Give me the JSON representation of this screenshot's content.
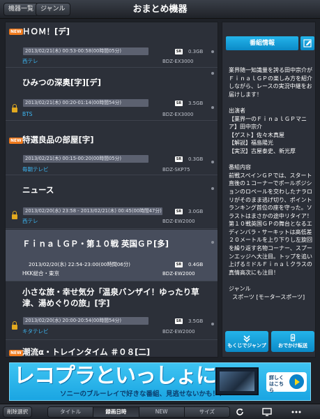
{
  "header": {
    "left_buttons": [
      "機器一覧",
      "ジャンル"
    ],
    "title": "おまとめ機器"
  },
  "list": [
    {
      "new": "NEW",
      "title": "ＨＯＭ！[デ]",
      "date": "2013/02/21(木) 00:53-00:58(00時間05分)",
      "sr": "SR",
      "size": "0.3GB",
      "channel": "西テレ",
      "device": "BDZ-EX3000",
      "locked": false,
      "selected": false
    },
    {
      "new": "",
      "title": "ひみつの深奥[字][デ]",
      "date": "2013/02/21(木) 00:20-01:14(00時間54分)",
      "sr": "SR",
      "size": "3.5GB",
      "channel": "BTS",
      "device": "BDZ-EX3000",
      "locked": true,
      "selected": false
    },
    {
      "new": "NEW",
      "title": "特選良品の部屋[字]",
      "date": "2013/02/21(木) 00:15-00:20(00時間05分)",
      "sr": "SR",
      "size": "0.3GB",
      "channel": "毎朝テレビ",
      "device": "BDZ-SKP75",
      "locked": false,
      "selected": false
    },
    {
      "new": "",
      "title": "ニュース",
      "date": "2013/02/20(水) 23:58 - 2013/02/21(木) 00:45(00時間47分)",
      "sr": "SR",
      "size": "3.0GB",
      "channel": "西テレ",
      "device": "BDZ-EW2000",
      "locked": true,
      "selected": false
    },
    {
      "new": "",
      "title": "ＦｉｎａｌＧＰ・第１０戦 英国ＧＰ[多]",
      "date": "2013/02/20(水) 22:54-23:00(00時間06分)",
      "sr": "SR",
      "size": "0.4GB",
      "channel": "HKK総合・東京",
      "device": "BDZ-EW2000",
      "locked": false,
      "selected": true
    },
    {
      "new": "",
      "title": "小さな旅・幸せ気分「温泉バンザイ！ゆったり草津、湯めぐりの旅」[字]",
      "date": "2013/02/20(水) 20:00-20:54(00時間54分)",
      "sr": "SR",
      "size": "3.5GB",
      "channel": "キタテレビ",
      "device": "BDZ-EW2000",
      "locked": true,
      "selected": false
    },
    {
      "new": "NEW",
      "title": "潮流α・トレインタイム ＃０８[二]",
      "date": "",
      "sr": "",
      "size": "",
      "channel": "",
      "device": "",
      "locked": false,
      "selected": false
    }
  ],
  "panel": {
    "info_button": "番組情報",
    "description": "業界随一知識量を誇る田中宗介がＦｉｎａｌＧＰの楽しみ方を紹介しながら、レースの実況中継をお届けします！\n\n出演者\n【業界一のＦｉｎａｌＧＰマニア】田中宗介\n【ゲスト】佐々木真屋\n【解説】福島陽光\n【実況】古屋泰史、新光厚\n\n番組内容\n前戦スペインＧＰでは、スタート直後の１コーナーでポールポジションのロペールを交わしたナラロリがそのまま逃げ切り、ポイントランキング首位の座を守った。ソラストはまさかの途中リタイア！第１０戦英国ＧＰの舞台となるエディンバラ・サーキットは高低差２０メートルを上り下りし左旋回を繰り返す名物コーナー、スプーンエッジへ大注目。トップを追い上げるミドルＦｉｎａｌクラスの真情高次にも注目！\n\nジャンル\n  スポーツ [モータースポーツ]",
    "jump_button": "もくじでジャンプ",
    "transfer_button": "おでかけ転送"
  },
  "ad": {
    "main": "レコプラといっしょに",
    "sub": "ソニーのブルーレイで好きな番組、見逃せないかも！？",
    "detail": "詳しくはこちら"
  },
  "footer": {
    "delete_select": "削除選択",
    "sort_tabs": [
      "タイトル",
      "録画日時",
      "NEW",
      "サイズ"
    ],
    "active_tab": "録画日時"
  },
  "colors": {
    "accent": "#0b8ac7",
    "channel": "#3db6f2",
    "new_badge": "#f07a1c",
    "lock": "#e2a91f"
  }
}
